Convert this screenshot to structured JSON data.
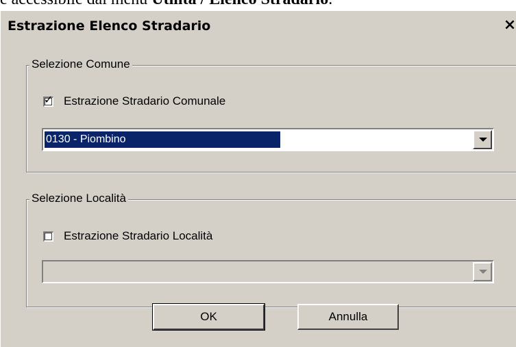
{
  "background_text": {
    "prefix": "e accessibile dal menu ",
    "bold": "Utilità / Elenco Stradario",
    "suffix": "."
  },
  "window": {
    "title": "Estrazione Elenco Stradario",
    "close_glyph": "×"
  },
  "group_comune": {
    "legend": "Selezione Comune",
    "checkbox_label": "Estrazione Stradario Comunale",
    "checkbox_checked": true,
    "tick_glyph": "✓",
    "selected_value": "0130 - Piombino"
  },
  "group_localita": {
    "legend": "Selezione Località",
    "checkbox_label": "Estrazione Stradario Località",
    "checkbox_checked": false,
    "selected_value": ""
  },
  "buttons": {
    "ok": "OK",
    "cancel": "Annulla"
  }
}
